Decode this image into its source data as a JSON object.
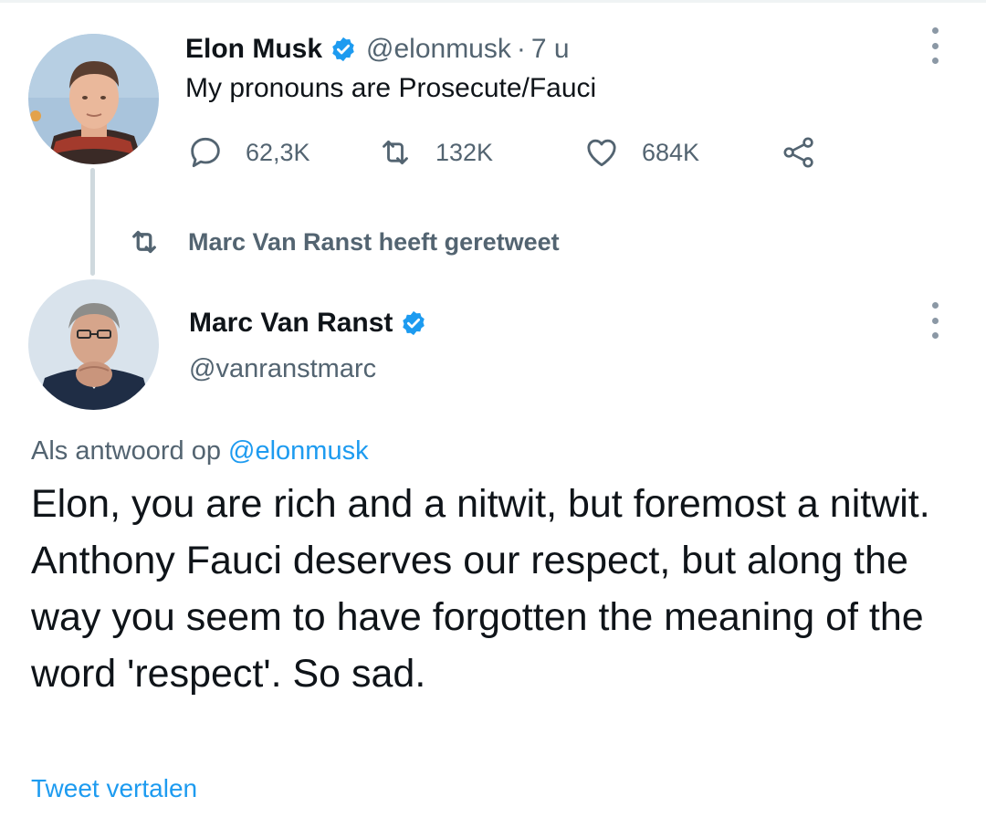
{
  "parent_tweet": {
    "display_name": "Elon Musk",
    "handle": "@elonmusk",
    "separator": "·",
    "time": "7 u",
    "text": "My pronouns are Prosecute/Fauci",
    "stats": {
      "replies": "62,3K",
      "retweets": "132K",
      "likes": "684K"
    }
  },
  "retweet_context": {
    "text": "Marc Van Ranst heeft geretweet"
  },
  "main_tweet": {
    "display_name": "Marc Van Ranst",
    "handle": "@vanranstmarc",
    "reply_prefix": "Als antwoord op ",
    "reply_mention": "@elonmusk",
    "text_para_1": "Elon, you are rich and a nitwit, but foremost a nitwit.",
    "text_para_2": "Anthony Fauci deserves our respect, but along the way you seem to have forgotten the meaning of the word 'respect'. So sad.",
    "translate_link": "Tweet vertalen"
  },
  "icons": {
    "reply": "speech-bubble-icon",
    "retweet": "retweet-arrows-icon",
    "like": "heart-outline-icon",
    "share": "share-nodes-icon",
    "verified": "verified-badge-icon",
    "more": "vertical-ellipsis-icon"
  },
  "colors": {
    "accent": "#1d9bf0",
    "secondary_text": "#536471",
    "primary_text": "#0f1419",
    "thread_line": "#cfd9de"
  }
}
